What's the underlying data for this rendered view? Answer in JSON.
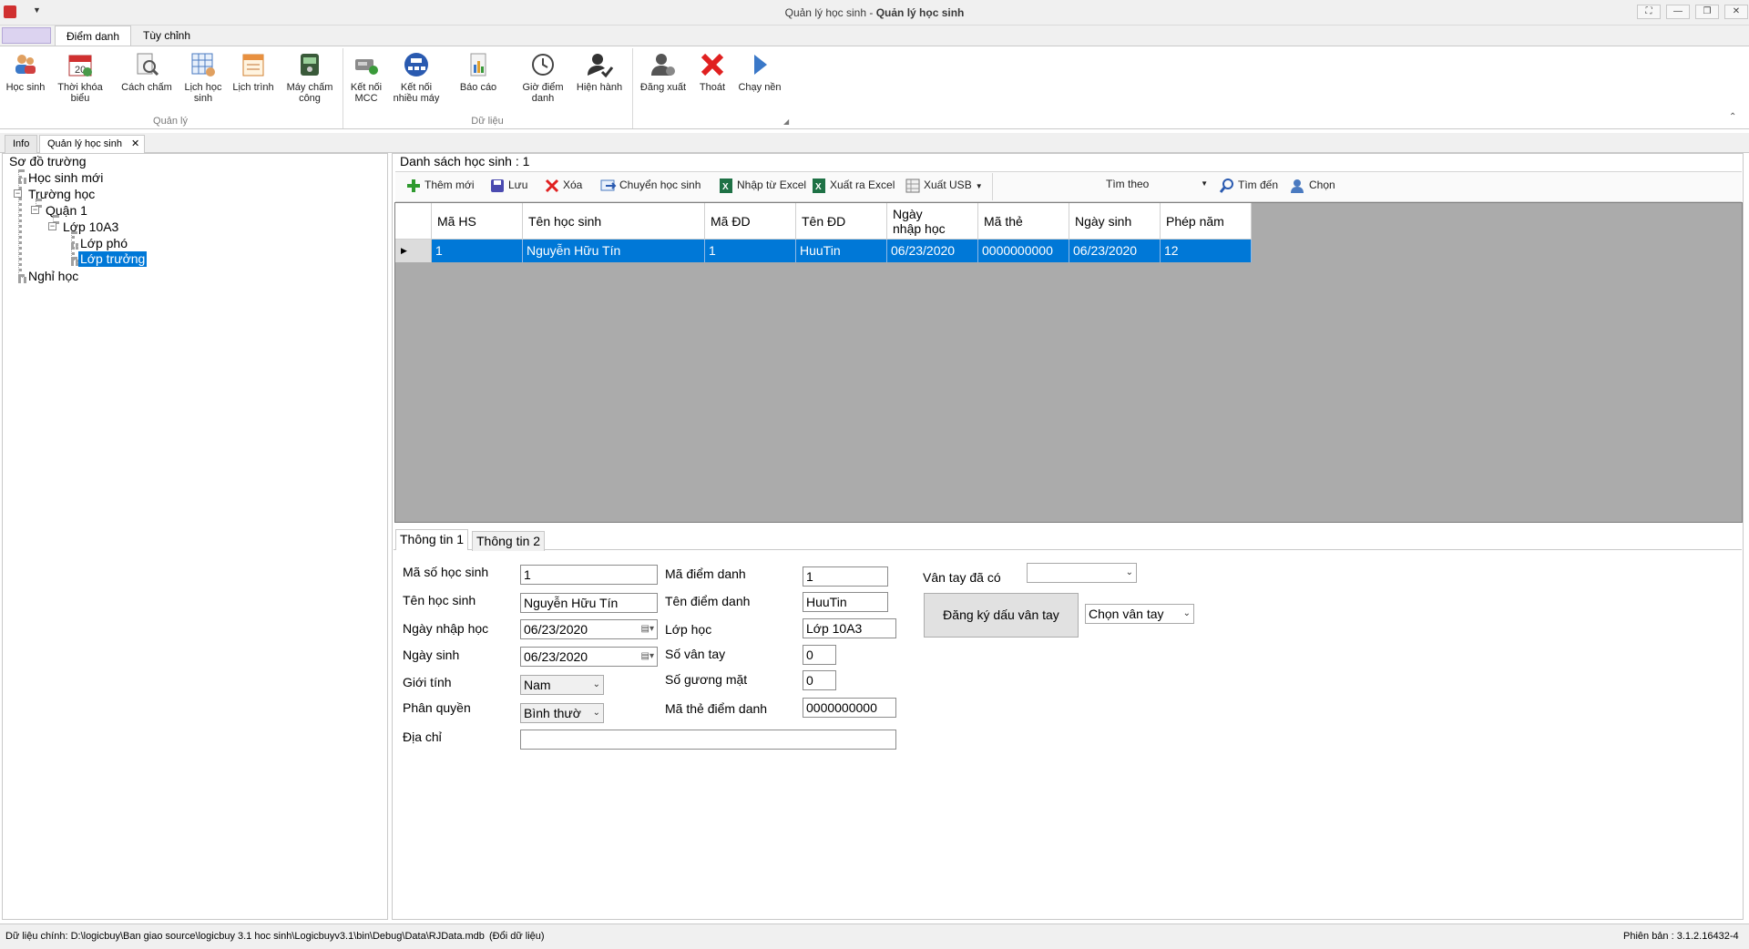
{
  "window": {
    "title_light": "Quản lý học sinh - ",
    "title_bold": "Quản lý học sinh"
  },
  "ribbon": {
    "tabs": [
      "Điểm danh",
      "Tùy chỉnh"
    ],
    "groups": [
      "Quản lý",
      "Dữ liệu"
    ],
    "buttons": {
      "hoc_sinh": "Học sinh",
      "thoi_khoa_bieu": "Thời khóa\nbiểu",
      "cach_cham": "Cách chấm",
      "lich_hoc_sinh": "Lịch học\nsinh",
      "lich_trinh": "Lịch trình",
      "may_cham_cong": "Máy chấm\ncông",
      "ket_noi_mcc": "Kết nối\nMCC",
      "ket_noi_nhieu_may": "Kết nối\nnhiều máy",
      "bao_cao": "Báo cáo",
      "gio_diem_danh": "Giờ điểm\ndanh",
      "hien_hanh": "Hiện hành",
      "dang_xuat": "Đăng xuất",
      "thoat": "Thoát",
      "chay_nen": "Chạy nền"
    }
  },
  "doc_tabs": [
    "Info",
    "Quản lý học sinh"
  ],
  "tree": {
    "root": "Sơ đồ trường",
    "items": [
      "Học sinh mới",
      "Trường học",
      "Quận 1",
      "Lớp 10A3",
      "Lớp phó",
      "Lớp trưởng",
      "Nghỉ học"
    ]
  },
  "list": {
    "header": "Danh sách học sinh : 1",
    "toolbar": {
      "add": "Thêm mới",
      "save": "Lưu",
      "delete": "Xóa",
      "move": "Chuyển học sinh",
      "import_excel": "Nhập từ Excel",
      "export_excel": "Xuất ra Excel",
      "export_usb": "Xuất USB",
      "search_by": "Tìm theo",
      "find": "Tìm đến",
      "select": "Chọn"
    },
    "columns": [
      "Mã HS",
      "Tên học sinh",
      "Mã ĐD",
      "Tên ĐD",
      "Ngày\nnhập học",
      "Mã thẻ",
      "Ngày sinh",
      "Phép năm"
    ],
    "rows": [
      [
        "1",
        "Nguyễn Hữu Tín",
        "1",
        "HuuTin",
        "06/23/2020",
        "0000000000",
        "06/23/2020",
        "12"
      ]
    ]
  },
  "info": {
    "tabs": [
      "Thông tin 1",
      "Thông tin 2"
    ],
    "labels": {
      "ma_so": "Mã số học sinh",
      "ten_hs": "Tên học sinh",
      "ngay_nhap_hoc": "Ngày nhập học",
      "ngay_sinh": "Ngày sinh",
      "gioi_tinh": "Giới tính",
      "phan_quyen": "Phân quyền",
      "dia_chi": "Địa chỉ",
      "ma_diem_danh": "Mã điểm danh",
      "ten_diem_danh": "Tên điểm danh",
      "lop_hoc": "Lớp học",
      "so_van_tay": "Số vân tay",
      "so_guong_mat": "Số gương mặt",
      "ma_the": "Mã thẻ điểm danh",
      "van_tay_da_co": "Vân tay đã có"
    },
    "values": {
      "ma_so": "1",
      "ten_hs": "Nguyễn Hữu Tín",
      "ngay_nhap_hoc": "06/23/2020",
      "ngay_sinh": "06/23/2020",
      "gioi_tinh": "Nam",
      "phan_quyen": "Bình thườ",
      "dia_chi": "",
      "ma_diem_danh": "1",
      "ten_diem_danh": "HuuTin",
      "lop_hoc": "Lớp 10A3",
      "so_van_tay": "0",
      "so_guong_mat": "0",
      "ma_the": "0000000000",
      "van_tay_da_co": "",
      "chon_van_tay": "Chọn vân tay"
    },
    "register_button": "Đăng ký dấu vân tay"
  },
  "status": {
    "data_path": "Dữ liệu chính: D:\\logicbuy\\Ban giao source\\logicbuy 3.1 hoc sinh\\Logicbuyv3.1\\bin\\Debug\\Data\\RJData.mdb",
    "change_data": "(Đổi dữ liệu)",
    "version": "Phiên bản : 3.1.2.16432-4"
  }
}
